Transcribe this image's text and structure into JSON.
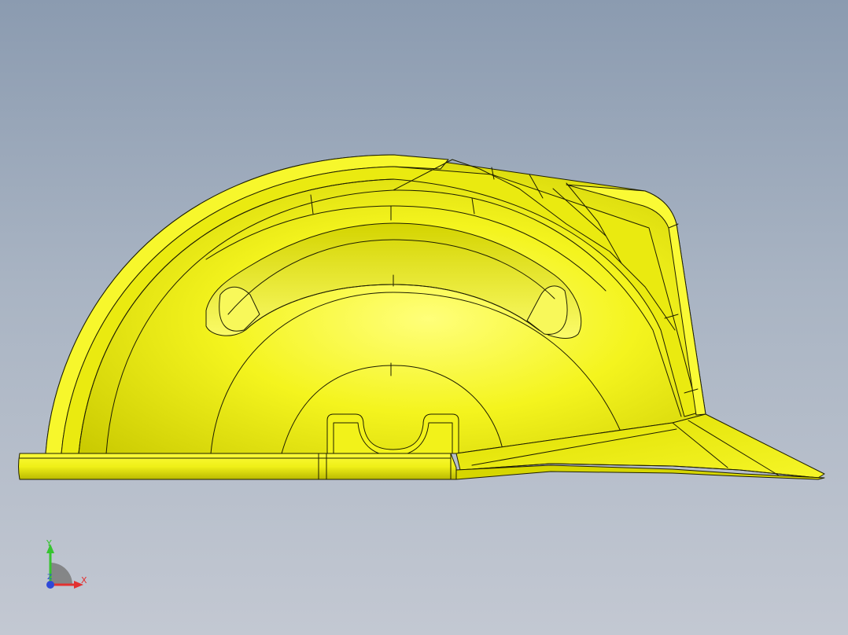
{
  "viewport": {
    "model_color": "#f2f21a",
    "edge_color": "#1e1e00",
    "background_top": "#8b9bb0",
    "background_bottom": "#c3c8d2"
  },
  "triad": {
    "x_label": "X",
    "y_label": "Y",
    "z_label": "Z",
    "x_color": "#e23131",
    "y_color": "#36c42f",
    "z_color": "#2f49d8"
  }
}
